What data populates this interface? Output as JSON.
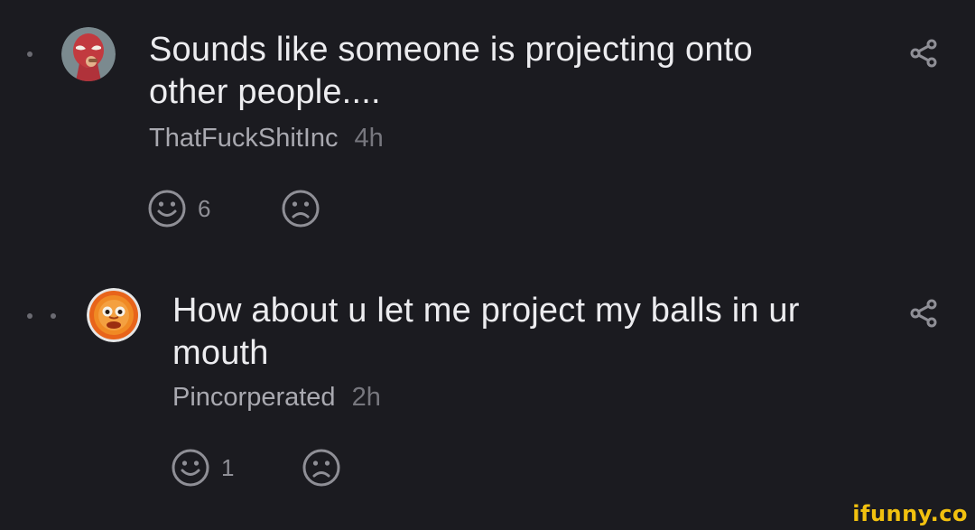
{
  "comments": [
    {
      "text": "Sounds like someone is projecting onto other people....",
      "author": "ThatFuckShitInc",
      "time": "4h",
      "likes": "6",
      "depth": 1,
      "avatar_icon": "spiderman-avatar-icon"
    },
    {
      "text": "How about u let me project my balls in ur mouth",
      "author": "Pincorperated",
      "time": "2h",
      "likes": "1",
      "depth": 2,
      "avatar_icon": "sun-face-avatar-icon"
    }
  ],
  "watermark": "ifunny.co",
  "colors": {
    "background": "#1b1b20",
    "text": "#ececef",
    "author": "#a9a9b0",
    "time": "#77777e",
    "icons": "#8f8f96",
    "watermark": "#f2c10f"
  }
}
